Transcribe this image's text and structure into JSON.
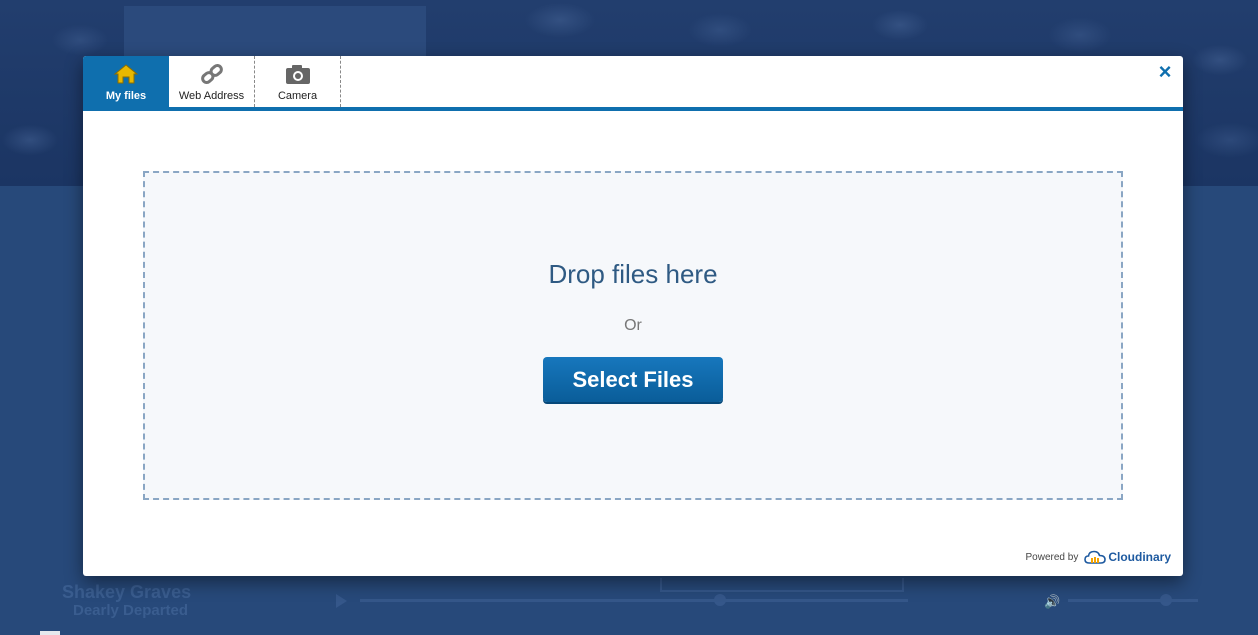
{
  "background": {
    "artist": "Shakey Graves",
    "song": "Dearly Departed"
  },
  "tabs": [
    {
      "label": "My files",
      "icon": "home-icon",
      "active": true
    },
    {
      "label": "Web Address",
      "icon": "link-icon",
      "active": false
    },
    {
      "label": "Camera",
      "icon": "camera-icon",
      "active": false
    }
  ],
  "close_label": "×",
  "dropzone": {
    "title": "Drop files here",
    "or": "Or",
    "button_label": "Select Files"
  },
  "footer": {
    "powered_by": "Powered by",
    "brand": "Cloudinary"
  },
  "colors": {
    "accent": "#0f6fae",
    "home_icon": "#e8b800",
    "brand_orange": "#f5a300"
  }
}
